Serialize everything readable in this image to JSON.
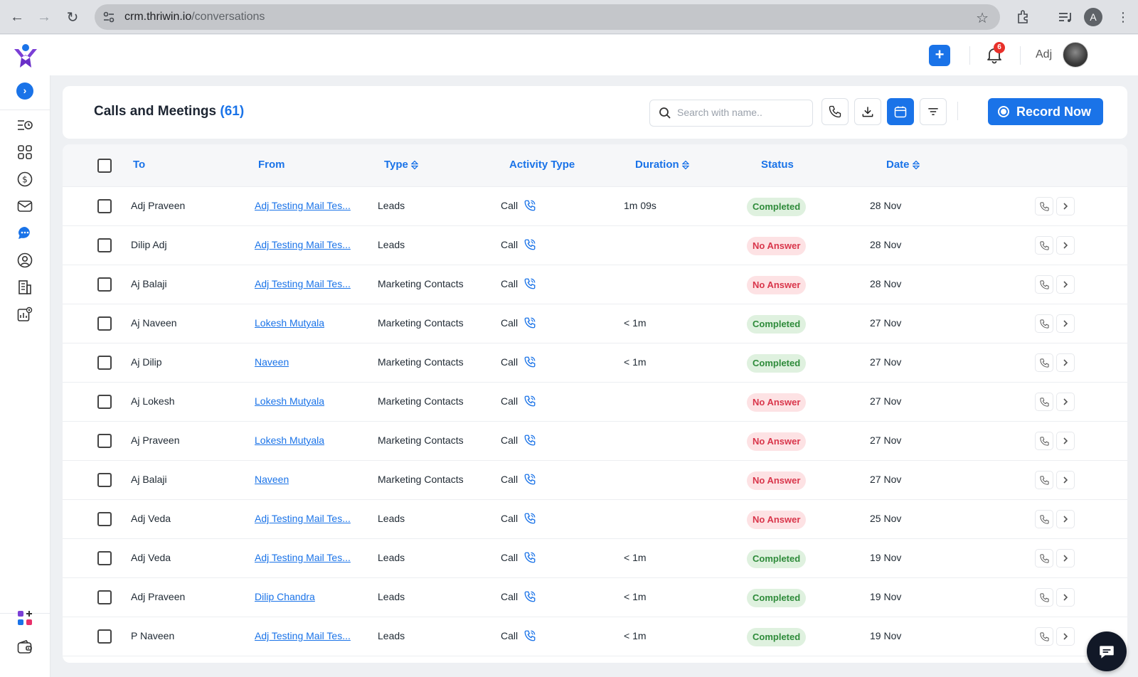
{
  "browser": {
    "url_host": "crm.thriwin.io",
    "url_path": "/conversations",
    "profile_initial": "A"
  },
  "header": {
    "notification_count": "6",
    "user_name": "Adj"
  },
  "page": {
    "title": "Calls and Meetings",
    "count": "(61)"
  },
  "search": {
    "placeholder": "Search with name.."
  },
  "toolbar": {
    "record_label": "Record Now"
  },
  "table": {
    "columns": {
      "to": "To",
      "from": "From",
      "type": "Type",
      "activity_type": "Activity Type",
      "duration": "Duration",
      "status": "Status",
      "date": "Date"
    },
    "rows": [
      {
        "to": "Adj Praveen",
        "from": "Adj Testing Mail Tes...",
        "type": "Leads",
        "activity": "Call",
        "duration": "1m 09s",
        "status": "Completed",
        "date": "28 Nov"
      },
      {
        "to": "Dilip Adj",
        "from": "Adj Testing Mail Tes...",
        "type": "Leads",
        "activity": "Call",
        "duration": "",
        "status": "No Answer",
        "date": "28 Nov"
      },
      {
        "to": "Aj Balaji",
        "from": "Adj Testing Mail Tes...",
        "type": "Marketing Contacts",
        "activity": "Call",
        "duration": "",
        "status": "No Answer",
        "date": "28 Nov"
      },
      {
        "to": "Aj Naveen",
        "from": "Lokesh Mutyala",
        "type": "Marketing Contacts",
        "activity": "Call",
        "duration": "< 1m",
        "status": "Completed",
        "date": "27 Nov"
      },
      {
        "to": "Aj Dilip",
        "from": "Naveen",
        "type": "Marketing Contacts",
        "activity": "Call",
        "duration": "< 1m",
        "status": "Completed",
        "date": "27 Nov"
      },
      {
        "to": "Aj Lokesh",
        "from": "Lokesh Mutyala",
        "type": "Marketing Contacts",
        "activity": "Call",
        "duration": "",
        "status": "No Answer",
        "date": "27 Nov"
      },
      {
        "to": "Aj Praveen",
        "from": "Lokesh Mutyala",
        "type": "Marketing Contacts",
        "activity": "Call",
        "duration": "",
        "status": "No Answer",
        "date": "27 Nov"
      },
      {
        "to": "Aj Balaji",
        "from": "Naveen",
        "type": "Marketing Contacts",
        "activity": "Call",
        "duration": "",
        "status": "No Answer",
        "date": "27 Nov"
      },
      {
        "to": "Adj Veda",
        "from": "Adj Testing Mail Tes...",
        "type": "Leads",
        "activity": "Call",
        "duration": "",
        "status": "No Answer",
        "date": "25 Nov"
      },
      {
        "to": "Adj Veda",
        "from": "Adj Testing Mail Tes...",
        "type": "Leads",
        "activity": "Call",
        "duration": "< 1m",
        "status": "Completed",
        "date": "19 Nov"
      },
      {
        "to": "Adj Praveen",
        "from": "Dilip Chandra",
        "type": "Leads",
        "activity": "Call",
        "duration": "< 1m",
        "status": "Completed",
        "date": "19 Nov"
      },
      {
        "to": "P Naveen",
        "from": "Adj Testing Mail Tes...",
        "type": "Leads",
        "activity": "Call",
        "duration": "< 1m",
        "status": "Completed",
        "date": "19 Nov"
      }
    ]
  },
  "colors": {
    "accent": "#1a73e8",
    "completed_bg": "#dff1df",
    "completed_text": "#2e8b3a",
    "noanswer_bg": "#fde2e4",
    "noanswer_text": "#d9364b"
  },
  "icons": {
    "sidebar": [
      "list-clock-icon",
      "grid-icon",
      "dollar-icon",
      "mail-icon",
      "chat-icon",
      "user-circle-icon",
      "building-icon",
      "report-settings-icon"
    ],
    "sidebar_bottom": [
      "apps-add-icon",
      "wallet-icon"
    ],
    "toolbar": [
      "phone-icon",
      "download-icon",
      "calendar-icon",
      "filter-icon"
    ]
  }
}
